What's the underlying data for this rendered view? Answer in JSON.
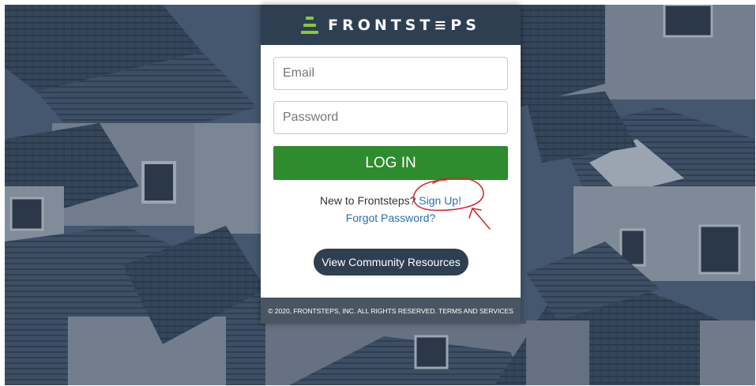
{
  "brand": {
    "name": "FRONTST≡PS",
    "accent_color": "#8bc53f",
    "header_color": "#2f3f52"
  },
  "form": {
    "email_placeholder": "Email",
    "password_placeholder": "Password",
    "login_label": "LOG IN",
    "login_color": "#2e8b2e"
  },
  "links": {
    "signup_prompt": "New to Frontsteps?",
    "signup_label": "Sign Up!",
    "forgot_label": "Forgot Password?"
  },
  "community": {
    "button_label": "View Community Resources"
  },
  "footer": {
    "text": "© 2020, FRONTSTEPS, INC. ALL RIGHTS RESERVED. TERMS AND SERVICES"
  },
  "annotation": {
    "color": "#d42a2a",
    "shape": "circle-and-arrow"
  },
  "background": {
    "description_icon": "houses-photo"
  }
}
